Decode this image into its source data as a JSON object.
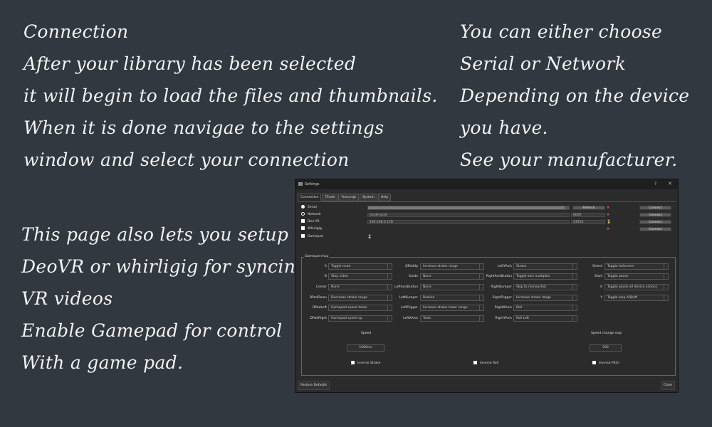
{
  "notes": {
    "left_top": [
      "Connection",
      "After your library has been selected",
      "it will begin to load the files and thumbnails.",
      "When it is done navigae to the settings",
      "window and select your connection"
    ],
    "right_top": [
      "You can either choose",
      "Serial or Network",
      "Depending on the device",
      "you have.",
      "See your manufacturer."
    ],
    "left_bottom": [
      "This page also lets you setup",
      "DeoVR or whirligig for syncing",
      "VR videos",
      "Enable Gamepad for control",
      "With a game pad."
    ]
  },
  "window": {
    "title": "Settings",
    "help": "?",
    "close": "✕",
    "tabs": [
      "Connection",
      "TCode",
      "Funscript",
      "System",
      "Help"
    ],
    "connection": {
      "serial_label": "Serial",
      "network_label": "Network",
      "deovr_label": "Deo VR",
      "whirligig_label": "Whirligig",
      "gamepad_label": "Gamepad",
      "network_host": "tcode.local",
      "network_port": "8000",
      "deovr_host": "192.168.0.178",
      "deovr_port": "23554",
      "refresh_button": "Refresh",
      "connect_button": "Connect"
    },
    "gamepad_map": {
      "title": "Gamepad map",
      "col1": [
        {
          "label": "A",
          "value": "Toggle mute"
        },
        {
          "label": "B",
          "value": "Stop video"
        },
        {
          "label": "Center",
          "value": "None"
        },
        {
          "label": "DPadDown",
          "value": "Decrease stroke range"
        },
        {
          "label": "DPadLeft",
          "value": "Gamepad speed down"
        },
        {
          "label": "DPadRight",
          "value": "Gamepad speed up"
        }
      ],
      "col2": [
        {
          "label": "DPadUp",
          "value": "Increase stroke range"
        },
        {
          "label": "Guide",
          "value": "None"
        },
        {
          "label": "LeftAxisButton",
          "value": "None"
        },
        {
          "label": "LeftBumper",
          "value": "Rewind"
        },
        {
          "label": "LeftTrigger",
          "value": "Increase stroke lower range"
        },
        {
          "label": "LeftXAxis",
          "value": "Twist"
        }
      ],
      "col3": [
        {
          "label": "LeftYAxis",
          "value": "Stroke"
        },
        {
          "label": "RightAxisButton",
          "value": "Toggle axis multiplier"
        },
        {
          "label": "RightBumper",
          "value": "Skip to moneyshot"
        },
        {
          "label": "RightTrigger",
          "value": "Increase stroke range"
        },
        {
          "label": "RightXAxis",
          "value": "Roll"
        },
        {
          "label": "RightYAxis",
          "value": "Roll Left"
        }
      ],
      "col4": [
        {
          "label": "Select",
          "value": "Toggle fullscreen"
        },
        {
          "label": "Start",
          "value": "Toggle pause"
        },
        {
          "label": "X",
          "value": "Toggle pause all device actions"
        },
        {
          "label": "Y",
          "value": "Toggle loop A/B/off"
        }
      ],
      "speed_label": "Speed",
      "speed_value": "1000ms",
      "speed_step_label": "Speed change step",
      "speed_step_value": "500",
      "inverse_stroke": "Inverse Stroke",
      "inverse_roll": "Inverse Roll",
      "inverse_pitch": "Inverse Pitch"
    },
    "restore_defaults": "Restore Defaults",
    "close_button": "Close"
  }
}
